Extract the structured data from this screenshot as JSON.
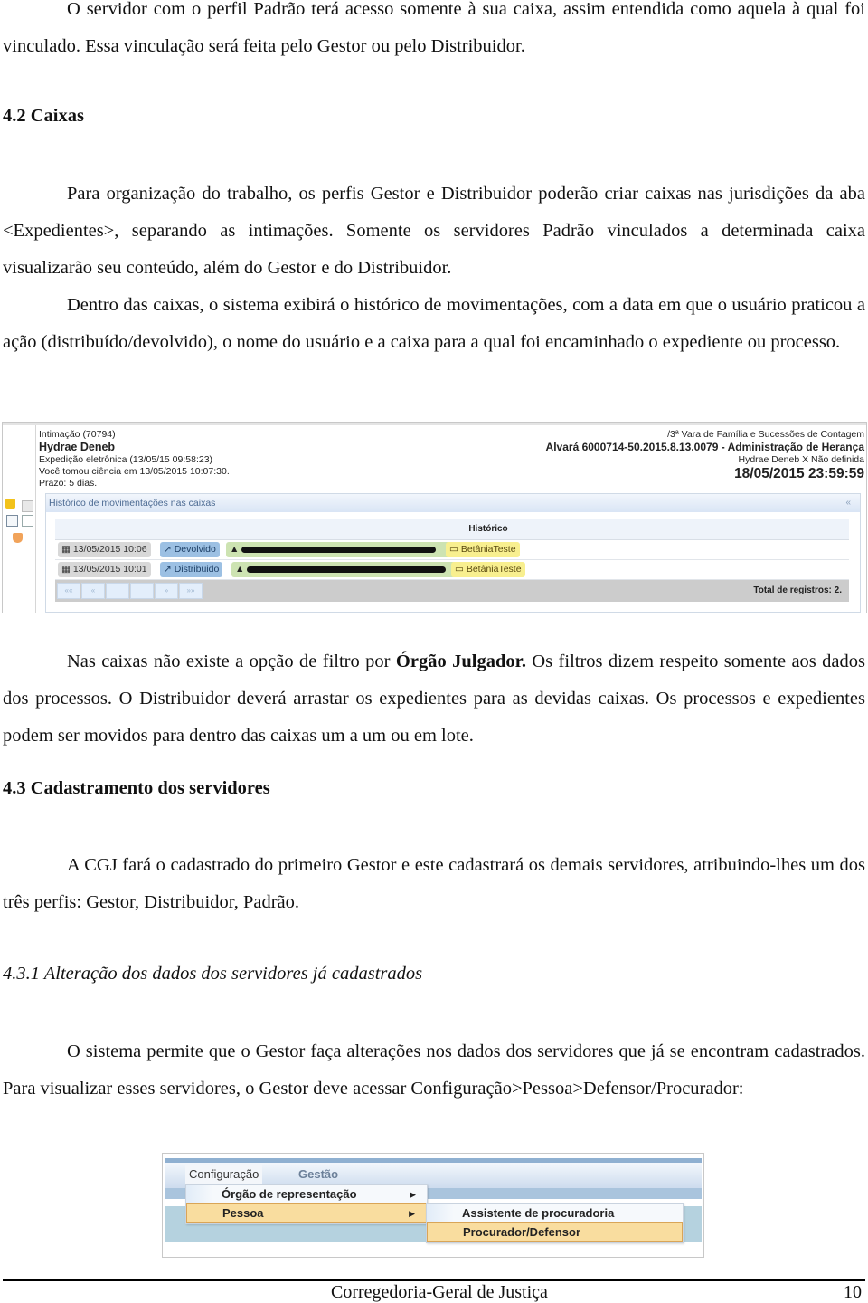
{
  "paragraphs": {
    "p1": "O servidor com o perfil Padrão terá acesso somente à sua caixa, assim entendida como aquela à qual foi vinculado. Essa vinculação será feita pelo Gestor ou pelo Distribuidor.",
    "h42": "4.2 Caixas",
    "p2": "Para organização do trabalho, os perfis Gestor e Distribuidor poderão criar caixas nas jurisdições da aba <Expedientes>, separando as intimações. Somente os servidores Padrão vinculados a determinada caixa visualizarão seu conteúdo, além do Gestor e do Distribuidor.",
    "p3": "Dentro das caixas, o sistema exibirá o histórico de movimentações, com a data em que o usuário praticou a ação (distribuído/devolvido), o nome do usuário e a caixa para a qual foi encaminhado o expediente ou processo.",
    "p4_a": "Nas caixas não existe a opção de filtro por ",
    "p4_bold": "Órgão Julgador.",
    "p4_b": " Os filtros dizem respeito somente aos dados dos processos. O Distribuidor deverá arrastar os expedientes para as devidas caixas. Os processos e expedientes podem ser movidos para dentro das caixas um a um ou em lote.",
    "h43": "4.3 Cadastramento dos servidores",
    "p5": "A CGJ fará o cadastrado do primeiro Gestor e este cadastrará os demais servidores, atribuindo-lhes um dos três perfis: Gestor, Distribuidor, Padrão.",
    "h431": "4.3.1 Alteração dos dados dos servidores já cadastrados",
    "p6": "O sistema permite que o Gestor faça alterações nos dados dos servidores que já se encontram cadastrados. Para visualizar esses servidores, o Gestor deve acessar Configuração>Pessoa>Defensor/Procurador:"
  },
  "screenshot1": {
    "intimacao": "Intimação (70794)",
    "name": "Hydrae Deneb",
    "expedicao": "Expedição eletrônica (13/05/15 09:58:23)",
    "ciencia": "Você tomou ciência em 13/05/2015 10:07:30.",
    "prazo": "Prazo: 5 dias.",
    "vara": "/3ª Vara de Família e Sucessões de Contagem",
    "alvara": "Alvará 6000714-50.2015.8.13.0079 - Administração de Herança",
    "partes": "Hydrae Deneb X Não definida",
    "deadline": "18/05/2015 23:59:59",
    "panel_title": "Histórico de movimentações nas caixas",
    "collapse_glyph": "«",
    "column_header": "Histórico",
    "rows": [
      {
        "date": "13/05/2015 10:06",
        "action": "Devolvido",
        "user": "[redacted]",
        "box": "BetâniaTeste"
      },
      {
        "date": "13/05/2015 10:01",
        "action": "Distribuido",
        "user": "[redacted]",
        "box": "BetâniaTeste"
      }
    ],
    "pager": [
      "««",
      "«",
      "",
      "",
      "»",
      "»»"
    ],
    "total": "Total de registros: 2."
  },
  "screenshot2": {
    "menu_top": [
      "Configuração",
      "Gestão"
    ],
    "menu_items": [
      "Órgão de representação",
      "Pessoa"
    ],
    "submenu_items": [
      "Assistente de procuradoria",
      "Procurador/Defensor"
    ],
    "arrow": "▶"
  },
  "footer": {
    "title": "Corregedoria-Geral de Justiça",
    "page": "10"
  }
}
